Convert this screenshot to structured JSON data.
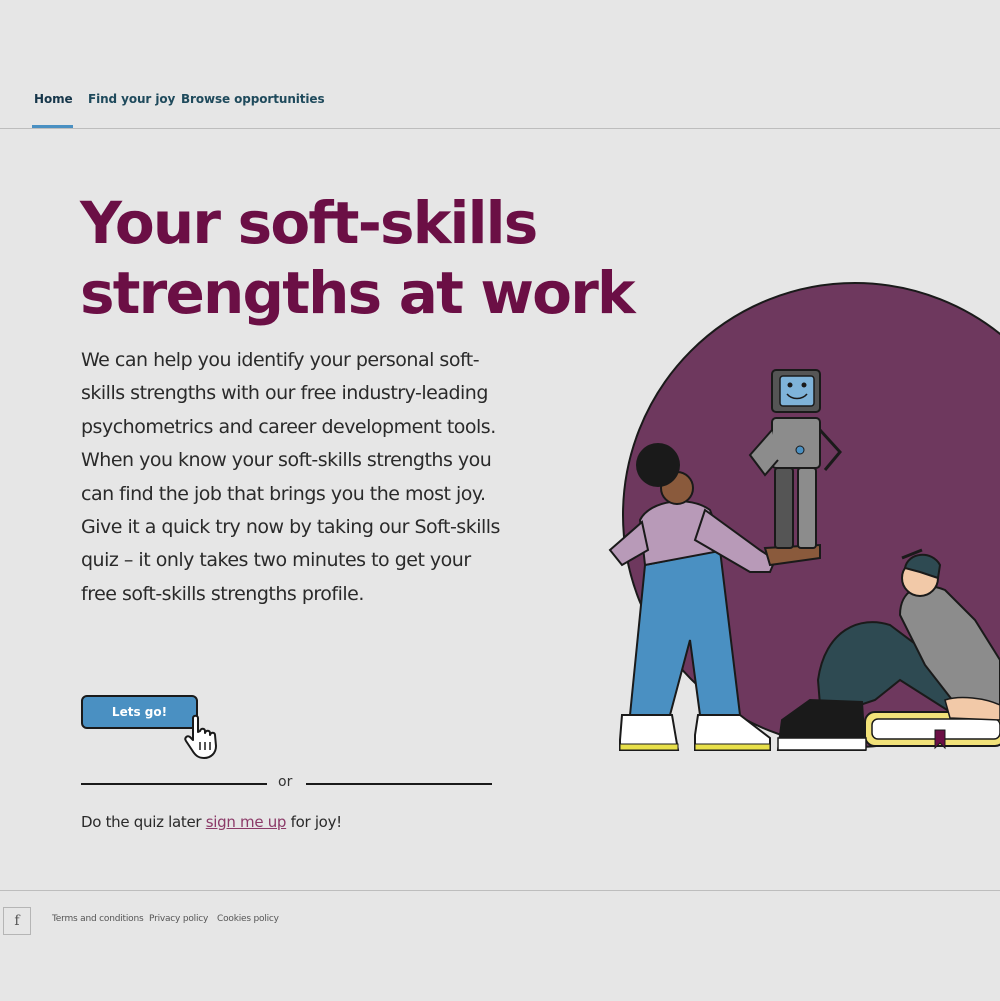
{
  "nav": {
    "items": [
      {
        "label": "Home",
        "active": true
      },
      {
        "label": "Find your joy",
        "active": false
      },
      {
        "label": "Browse opportunities",
        "active": false
      }
    ]
  },
  "hero": {
    "headline": "Your soft-skills strengths at work",
    "body": "We can help you identify your personal soft-skills strengths with our free industry-leading psychometrics and career development tools. When you know your soft-skills strengths you can find the job that brings you the most joy. Give it a quick try now by taking our Soft-skills quiz – it only takes two minutes to get your free soft-skills strengths profile.",
    "cta_label": "Lets go!",
    "divider_text": "or",
    "later_prefix": "Do the quiz later",
    "later_link": "sign me up",
    "later_suffix": "for joy!"
  },
  "footer": {
    "social_icon": "facebook-icon",
    "facebook_label": "f",
    "links": [
      "Terms and conditions",
      "Privacy policy",
      "Cookies policy"
    ]
  },
  "colors": {
    "background": "#e6e6e6",
    "headline": "#6b0f45",
    "accent_blue": "#4a90c2",
    "circle": "#6e385e",
    "link": "#8b3a68"
  }
}
